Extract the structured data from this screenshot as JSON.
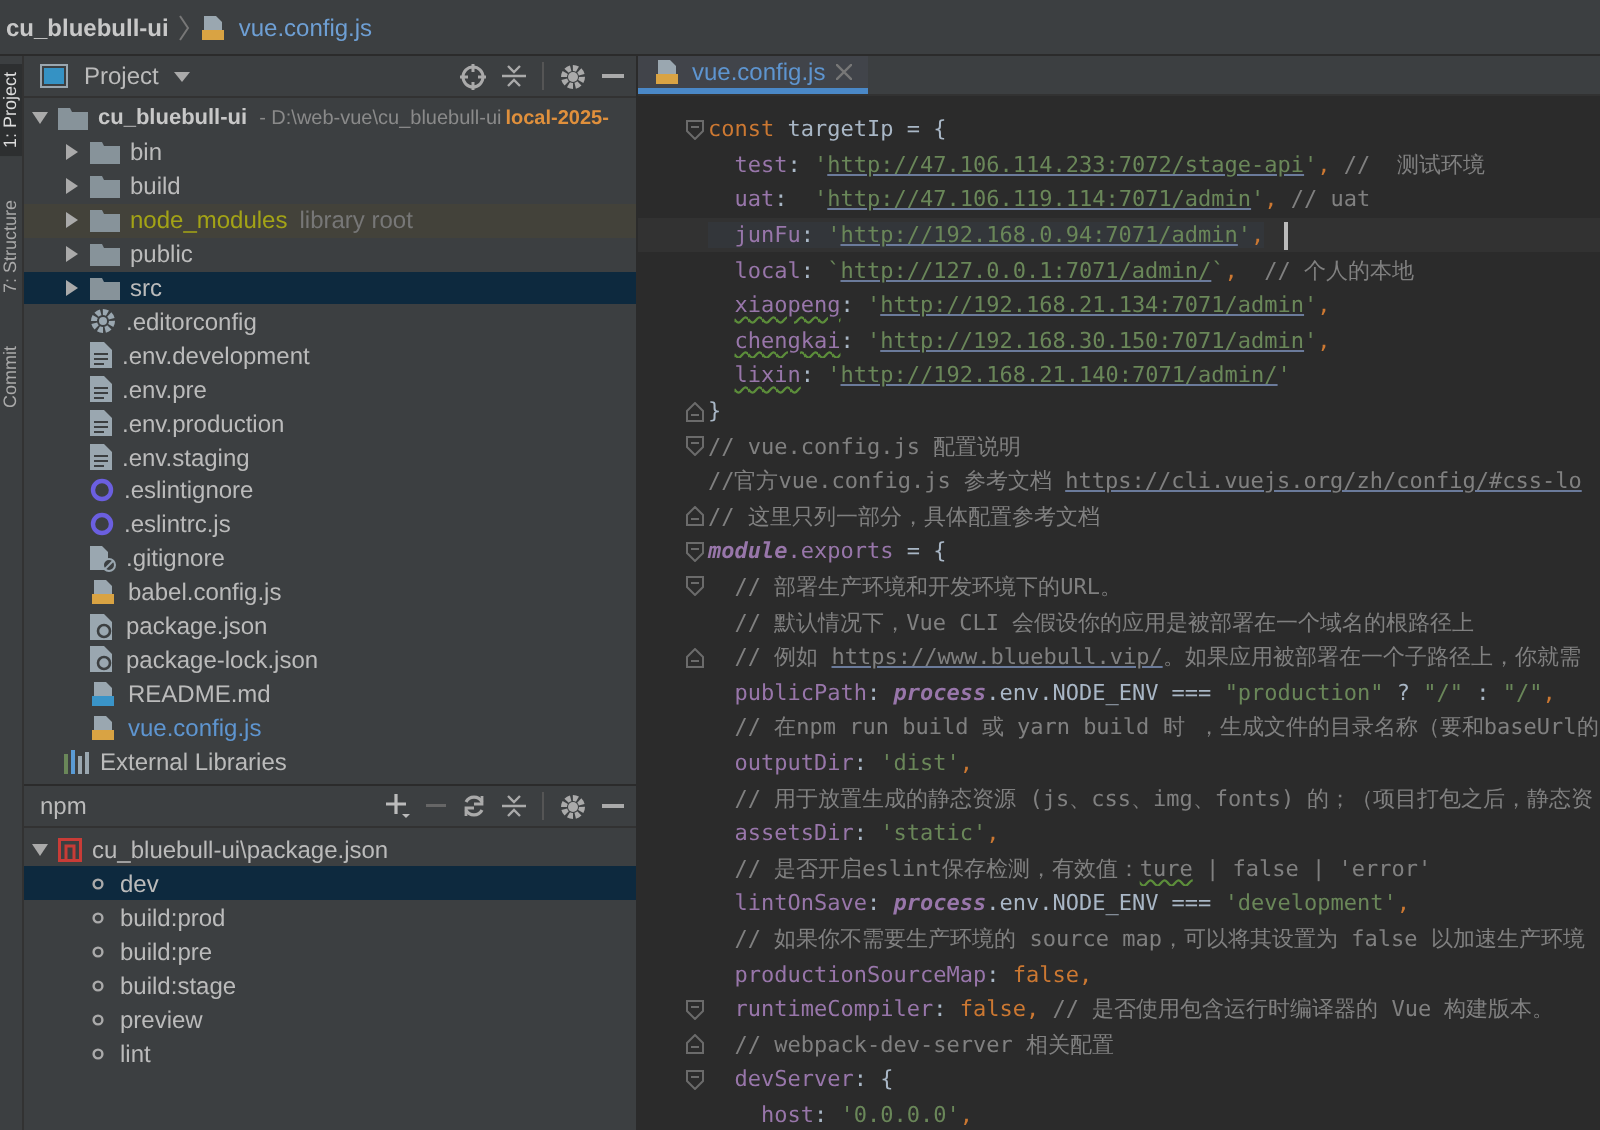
{
  "nav_bar": {
    "project": "cu_bluebull-ui",
    "file": "vue.config.js"
  },
  "tool_strip": [
    {
      "label": "1: Project",
      "selected": true
    },
    {
      "label": "7: Structure",
      "selected": false
    },
    {
      "label": "Commit",
      "selected": false
    }
  ],
  "project_panel": {
    "title": "Project",
    "tree": [
      {
        "name": "cu_bluebull-ui",
        "path": "- D:\\web-vue\\cu_bluebull-ui",
        "branch": "local-2025-",
        "kind": "folder",
        "expanded": true,
        "selected": false,
        "children": [
          {
            "name": "bin",
            "kind": "folder",
            "expanded": false,
            "selected": false,
            "modified": false
          },
          {
            "name": "build",
            "kind": "folder",
            "expanded": false,
            "selected": false,
            "modified": false
          },
          {
            "name": "node_modules",
            "note": "library root",
            "kind": "library",
            "expanded": false,
            "selected": false,
            "modified": false
          },
          {
            "name": "public",
            "kind": "folder",
            "expanded": false,
            "selected": false,
            "modified": false
          },
          {
            "name": "src",
            "kind": "folder",
            "expanded": false,
            "selected": true,
            "modified": false
          },
          {
            "name": ".editorconfig",
            "kind": "config",
            "selected": false,
            "modified": false
          },
          {
            "name": ".env.development",
            "kind": "text",
            "selected": false,
            "modified": false
          },
          {
            "name": ".env.pre",
            "kind": "text",
            "selected": false,
            "modified": false
          },
          {
            "name": ".env.production",
            "kind": "text",
            "selected": false,
            "modified": false
          },
          {
            "name": ".env.staging",
            "kind": "text",
            "selected": false,
            "modified": false
          },
          {
            "name": ".eslintignore",
            "kind": "eslint",
            "selected": false,
            "modified": false
          },
          {
            "name": ".eslintrc.js",
            "kind": "eslint",
            "selected": false,
            "modified": false
          },
          {
            "name": ".gitignore",
            "kind": "ignore",
            "selected": false,
            "modified": false
          },
          {
            "name": "babel.config.js",
            "kind": "js",
            "selected": false,
            "modified": false
          },
          {
            "name": "package.json",
            "kind": "json",
            "selected": false,
            "modified": false
          },
          {
            "name": "package-lock.json",
            "kind": "json",
            "selected": false,
            "modified": false
          },
          {
            "name": "README.md",
            "kind": "md",
            "selected": false,
            "modified": false
          },
          {
            "name": "vue.config.js",
            "kind": "js",
            "selected": false,
            "modified": true
          }
        ]
      },
      {
        "name": "External Libraries",
        "kind": "libraries",
        "selected": false
      }
    ]
  },
  "npm_panel": {
    "title": "npm",
    "package": "cu_bluebull-ui\\package.json",
    "expanded": true,
    "scripts": [
      {
        "name": "dev",
        "selected": true
      },
      {
        "name": "build:prod",
        "selected": false
      },
      {
        "name": "build:pre",
        "selected": false
      },
      {
        "name": "build:stage",
        "selected": false
      },
      {
        "name": "preview",
        "selected": false
      },
      {
        "name": "lint",
        "selected": false
      }
    ]
  },
  "editor": {
    "tabs": [
      {
        "label": "vue.config.js",
        "selected": true
      }
    ],
    "lines": [
      {
        "kind": "fold_start",
        "current": false,
        "tokens": [
          {
            "kind": "kw",
            "text": "const "
          },
          {
            "kind": "plain",
            "text": "targetIp = {"
          }
        ]
      },
      {
        "kind": "plain",
        "current": false,
        "tokens": [
          {
            "kind": "key",
            "text": "  test"
          },
          {
            "kind": "plain",
            "text": ": "
          },
          {
            "kind": "str",
            "text": "'"
          },
          {
            "kind": "url",
            "text": "http://47.106.114.233:7072/stage-api"
          },
          {
            "kind": "str",
            "text": "'"
          },
          {
            "kind": "punct",
            "text": ", "
          },
          {
            "kind": "cmt",
            "text": "//  测试环境"
          }
        ]
      },
      {
        "kind": "plain",
        "current": false,
        "tokens": [
          {
            "kind": "key",
            "text": "  uat"
          },
          {
            "kind": "plain",
            "text": ":  "
          },
          {
            "kind": "str",
            "text": "'"
          },
          {
            "kind": "url",
            "text": "http://47.106.119.114:7071/admin"
          },
          {
            "kind": "str",
            "text": "'"
          },
          {
            "kind": "punct",
            "text": ", "
          },
          {
            "kind": "cmt",
            "text": "// uat"
          }
        ]
      },
      {
        "kind": "plain",
        "current": true,
        "tokens": [
          {
            "kind": "key",
            "text": "  junFu"
          },
          {
            "kind": "plain",
            "text": ": "
          },
          {
            "kind": "str",
            "text": "'"
          },
          {
            "kind": "url",
            "text": "http://192.168.0.94:7071/admin"
          },
          {
            "kind": "str",
            "text": "'"
          },
          {
            "kind": "punct",
            "text": ","
          }
        ]
      },
      {
        "kind": "plain",
        "current": false,
        "tokens": [
          {
            "kind": "key",
            "text": "  local"
          },
          {
            "kind": "plain",
            "text": ": "
          },
          {
            "kind": "str",
            "text": "`"
          },
          {
            "kind": "url",
            "text": "http://127.0.0.1:7071/admin/"
          },
          {
            "kind": "str",
            "text": "`"
          },
          {
            "kind": "punct",
            "text": ",  "
          },
          {
            "kind": "cmt",
            "text": "// 个人的本地"
          }
        ]
      },
      {
        "kind": "plain",
        "current": false,
        "tokens": [
          {
            "kind": "key_typo",
            "text": "  xiaopeng"
          },
          {
            "kind": "plain",
            "text": ": "
          },
          {
            "kind": "str",
            "text": "'"
          },
          {
            "kind": "url",
            "text": "http://192.168.21.134:7071/admin"
          },
          {
            "kind": "str",
            "text": "'"
          },
          {
            "kind": "punct",
            "text": ","
          }
        ]
      },
      {
        "kind": "plain",
        "current": false,
        "tokens": [
          {
            "kind": "key_typo",
            "text": "  chengkai"
          },
          {
            "kind": "plain",
            "text": ": "
          },
          {
            "kind": "str",
            "text": "'"
          },
          {
            "kind": "url",
            "text": "http://192.168.30.150:7071/admin"
          },
          {
            "kind": "str",
            "text": "'"
          },
          {
            "kind": "punct",
            "text": ","
          }
        ]
      },
      {
        "kind": "plain",
        "current": false,
        "tokens": [
          {
            "kind": "key_typo",
            "text": "  lixin"
          },
          {
            "kind": "plain",
            "text": ": "
          },
          {
            "kind": "str",
            "text": "'"
          },
          {
            "kind": "url",
            "text": "http://192.168.21.140:7071/admin/"
          },
          {
            "kind": "str",
            "text": "'"
          }
        ]
      },
      {
        "kind": "fold_end",
        "current": false,
        "tokens": [
          {
            "kind": "plain",
            "text": "}"
          }
        ]
      },
      {
        "kind": "fold_start",
        "current": false,
        "tokens": [
          {
            "kind": "cmt",
            "text": "// vue.config.js 配置说明"
          }
        ]
      },
      {
        "kind": "plain",
        "current": false,
        "tokens": [
          {
            "kind": "cmt",
            "text": "//官方vue.config.js 参考文档 "
          },
          {
            "kind": "cmt_url",
            "text": "https://cli.vuejs.org/zh/config/#css-lo"
          }
        ]
      },
      {
        "kind": "fold_end",
        "current": false,
        "tokens": [
          {
            "kind": "cmt",
            "text": "// 这里只列一部分，具体配置参考文档"
          }
        ]
      },
      {
        "kind": "fold_start",
        "current": false,
        "tokens": [
          {
            "kind": "ital",
            "text": "module"
          },
          {
            "kind": "key",
            "text": ".exports"
          },
          {
            "kind": "plain",
            "text": " = {"
          }
        ]
      },
      {
        "kind": "fold_start",
        "current": false,
        "tokens": [
          {
            "kind": "cmt",
            "text": "  // 部署生产环境和开发环境下的URL。"
          }
        ]
      },
      {
        "kind": "plain",
        "current": false,
        "tokens": [
          {
            "kind": "cmt",
            "text": "  // 默认情况下，Vue CLI 会假设你的应用是被部署在一个域名的根路径上"
          }
        ]
      },
      {
        "kind": "fold_end",
        "current": false,
        "tokens": [
          {
            "kind": "cmt",
            "text": "  // 例如 "
          },
          {
            "kind": "cmt_url",
            "text": "https://www.bluebull.vip/"
          },
          {
            "kind": "cmt",
            "text": "。如果应用被部署在一个子路径上，你就需"
          }
        ]
      },
      {
        "kind": "plain",
        "current": false,
        "tokens": [
          {
            "kind": "key",
            "text": "  publicPath"
          },
          {
            "kind": "plain",
            "text": ": "
          },
          {
            "kind": "ital",
            "text": "process"
          },
          {
            "kind": "plain",
            "text": ".env.NODE_ENV === "
          },
          {
            "kind": "str",
            "text": "\"production\""
          },
          {
            "kind": "plain",
            "text": " ? "
          },
          {
            "kind": "str",
            "text": "\"/\""
          },
          {
            "kind": "plain",
            "text": " : "
          },
          {
            "kind": "str",
            "text": "\"/\""
          },
          {
            "kind": "punct",
            "text": ","
          }
        ]
      },
      {
        "kind": "plain",
        "current": false,
        "tokens": [
          {
            "kind": "cmt",
            "text": "  // 在npm run build 或 yarn build 时 ，生成文件的目录名称（要和baseUrl的"
          }
        ]
      },
      {
        "kind": "plain",
        "current": false,
        "tokens": [
          {
            "kind": "key",
            "text": "  outputDir"
          },
          {
            "kind": "plain",
            "text": ": "
          },
          {
            "kind": "str",
            "text": "'dist'"
          },
          {
            "kind": "punct",
            "text": ","
          }
        ]
      },
      {
        "kind": "plain",
        "current": false,
        "tokens": [
          {
            "kind": "cmt",
            "text": "  // 用于放置生成的静态资源 (js、css、img、fonts) 的；（项目打包之后，静态资"
          }
        ]
      },
      {
        "kind": "plain",
        "current": false,
        "tokens": [
          {
            "kind": "key",
            "text": "  assetsDir"
          },
          {
            "kind": "plain",
            "text": ": "
          },
          {
            "kind": "str",
            "text": "'static'"
          },
          {
            "kind": "punct",
            "text": ","
          }
        ]
      },
      {
        "kind": "plain",
        "current": false,
        "tokens": [
          {
            "kind": "cmt",
            "text": "  // 是否开启eslint保存检测，有效值："
          },
          {
            "kind": "cmt_typo",
            "text": "ture"
          },
          {
            "kind": "cmt",
            "text": " | false | 'error'"
          }
        ]
      },
      {
        "kind": "plain",
        "current": false,
        "tokens": [
          {
            "kind": "key",
            "text": "  lintOnSave"
          },
          {
            "kind": "plain",
            "text": ": "
          },
          {
            "kind": "ital",
            "text": "process"
          },
          {
            "kind": "plain",
            "text": ".env.NODE_ENV === "
          },
          {
            "kind": "str",
            "text": "'development'"
          },
          {
            "kind": "punct",
            "text": ","
          }
        ]
      },
      {
        "kind": "plain",
        "current": false,
        "tokens": [
          {
            "kind": "cmt",
            "text": "  // 如果你不需要生产环境的 source map，可以将其设置为 false 以加速生产环境"
          }
        ]
      },
      {
        "kind": "plain",
        "current": false,
        "tokens": [
          {
            "kind": "key",
            "text": "  productionSourceMap"
          },
          {
            "kind": "plain",
            "text": ": "
          },
          {
            "kind": "kw",
            "text": "false,"
          }
        ]
      },
      {
        "kind": "fold_start",
        "current": false,
        "tokens": [
          {
            "kind": "key",
            "text": "  runtimeCompiler"
          },
          {
            "kind": "plain",
            "text": ": "
          },
          {
            "kind": "kw",
            "text": "false, "
          },
          {
            "kind": "cmt",
            "text": "// 是否使用包含运行时编译器的 Vue 构建版本。"
          }
        ]
      },
      {
        "kind": "fold_end",
        "current": false,
        "tokens": [
          {
            "kind": "cmt",
            "text": "  // webpack-dev-server 相关配置"
          }
        ]
      },
      {
        "kind": "fold_start",
        "current": false,
        "tokens": [
          {
            "kind": "key",
            "text": "  devServer"
          },
          {
            "kind": "plain",
            "text": ": {"
          }
        ]
      },
      {
        "kind": "plain",
        "current": false,
        "tokens": [
          {
            "kind": "key",
            "text": "    host"
          },
          {
            "kind": "plain",
            "text": ": "
          },
          {
            "kind": "str",
            "text": "'0.0.0.0'"
          },
          {
            "kind": "punct",
            "text": ","
          }
        ]
      }
    ]
  }
}
